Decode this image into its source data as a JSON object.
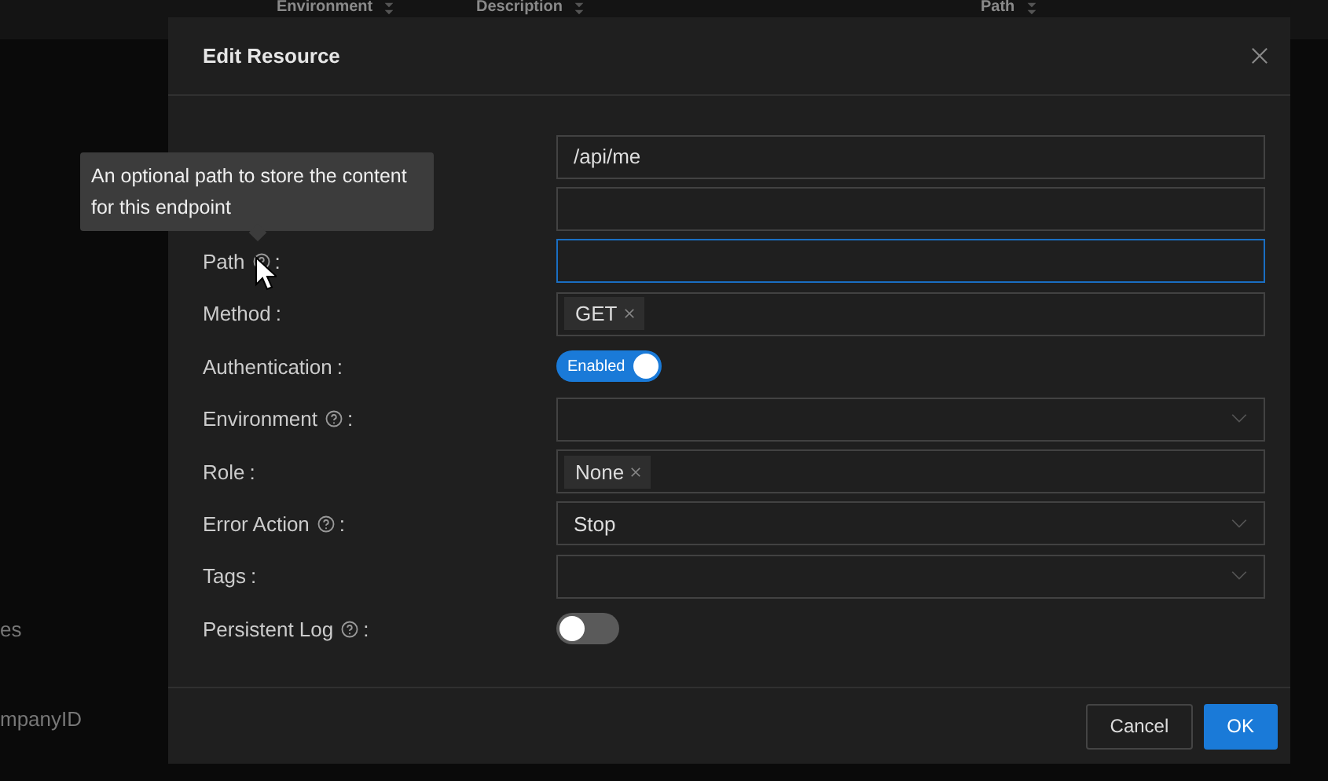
{
  "background_table": {
    "columns": [
      "Environment",
      "Description",
      "Path"
    ],
    "cells": [
      "es",
      "mpanyID"
    ]
  },
  "dialog": {
    "title": "Edit Resource",
    "fields": [
      {
        "kind": "input",
        "value": "/api/me",
        "focused": false
      },
      {
        "kind": "input",
        "focused": false
      },
      {
        "kind": "input",
        "label": "Path",
        "help": true,
        "colon": ":",
        "focused": true
      },
      {
        "kind": "tags",
        "label": "Method",
        "help": false,
        "colon": ":",
        "tags": [
          "GET"
        ]
      },
      {
        "kind": "toggle",
        "label": "Authentication",
        "help": false,
        "colon": ":",
        "on": true,
        "text": "Enabled"
      },
      {
        "kind": "select",
        "label": "Environment",
        "help": true,
        "colon": ":"
      },
      {
        "kind": "tags",
        "label": "Role",
        "help": false,
        "colon": ":",
        "tags": [
          "None"
        ]
      },
      {
        "kind": "select",
        "label": "Error Action",
        "help": true,
        "colon": ":",
        "value": "Stop"
      },
      {
        "kind": "select",
        "label": "Tags",
        "help": false,
        "colon": ":"
      },
      {
        "kind": "toggle",
        "label": "Persistent Log",
        "help": true,
        "colon": ":",
        "on": false
      }
    ],
    "buttons": [
      {
        "label": "Cancel",
        "primary": false
      },
      {
        "label": "OK",
        "primary": true
      }
    ]
  },
  "tooltip": {
    "text": "An optional path to store the content for this endpoint"
  }
}
